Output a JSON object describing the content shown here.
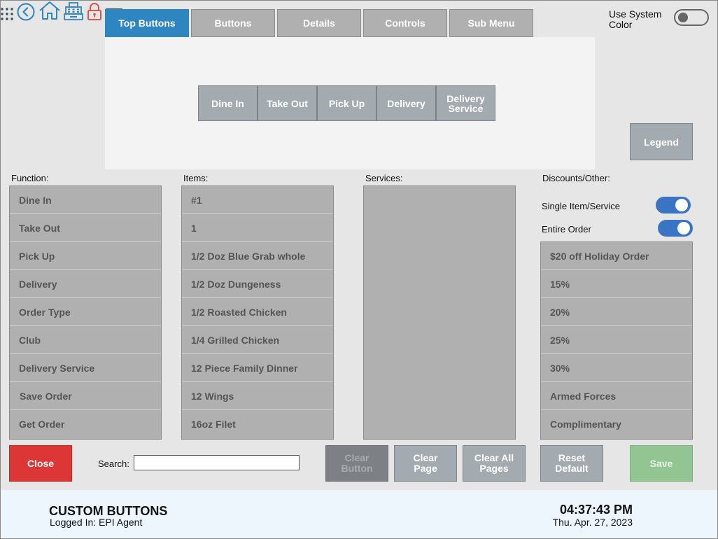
{
  "tabs": [
    "Top Buttons",
    "Buttons",
    "Details",
    "Controls",
    "Sub Menu"
  ],
  "active_tab": "Top Buttons",
  "use_system_color": {
    "label": "Use System Color",
    "enabled": false
  },
  "preview_buttons": [
    "Dine In",
    "Take Out",
    "Pick Up",
    "Delivery",
    "Delivery Service"
  ],
  "legend_label": "Legend",
  "function": {
    "label": "Function:",
    "items": [
      "Dine In",
      "Take Out",
      "Pick Up",
      "Delivery",
      "Order Type",
      "Club",
      "Delivery Service",
      "Save Order",
      "Get Order"
    ]
  },
  "items": {
    "label": "Items:",
    "items": [
      "#1",
      "1",
      "1/2 Doz Blue Grab whole",
      "1/2 Doz Dungeness",
      "1/2 Roasted Chicken",
      "1/4 Grilled Chicken",
      "12 Piece Family Dinner",
      "12 Wings",
      "16oz Filet"
    ]
  },
  "services": {
    "label": "Services:",
    "items": []
  },
  "discounts": {
    "label": "Discounts/Other:",
    "single_item_label": "Single Item/Service",
    "single_item_enabled": true,
    "entire_order_label": "Entire Order",
    "entire_order_enabled": true,
    "items": [
      "$20 off Holiday Order",
      "15%",
      "20%",
      "25%",
      "30%",
      "Armed Forces",
      "Complimentary"
    ]
  },
  "actions": {
    "close": "Close",
    "search_label": "Search:",
    "search_value": "",
    "clear_button": "Clear Button",
    "clear_page": "Clear Page",
    "clear_all_pages": "Clear All Pages",
    "reset_default": "Reset Default",
    "save": "Save"
  },
  "colors": {
    "accent": "#2e86c1",
    "close": "#dc3636",
    "save": "#93c593",
    "disabled": "#7d8186",
    "action": "#a3aab0"
  },
  "footer": {
    "title": "CUSTOM BUTTONS",
    "logged_in": "Logged In:  EPI Agent",
    "time": "04:37:43 PM",
    "date": "Thu. Apr. 27, 2023",
    "icons": [
      "apps-grid-icon",
      "back-circle-icon",
      "home-icon",
      "register-icon",
      "lock-icon",
      "menu-icon"
    ]
  }
}
